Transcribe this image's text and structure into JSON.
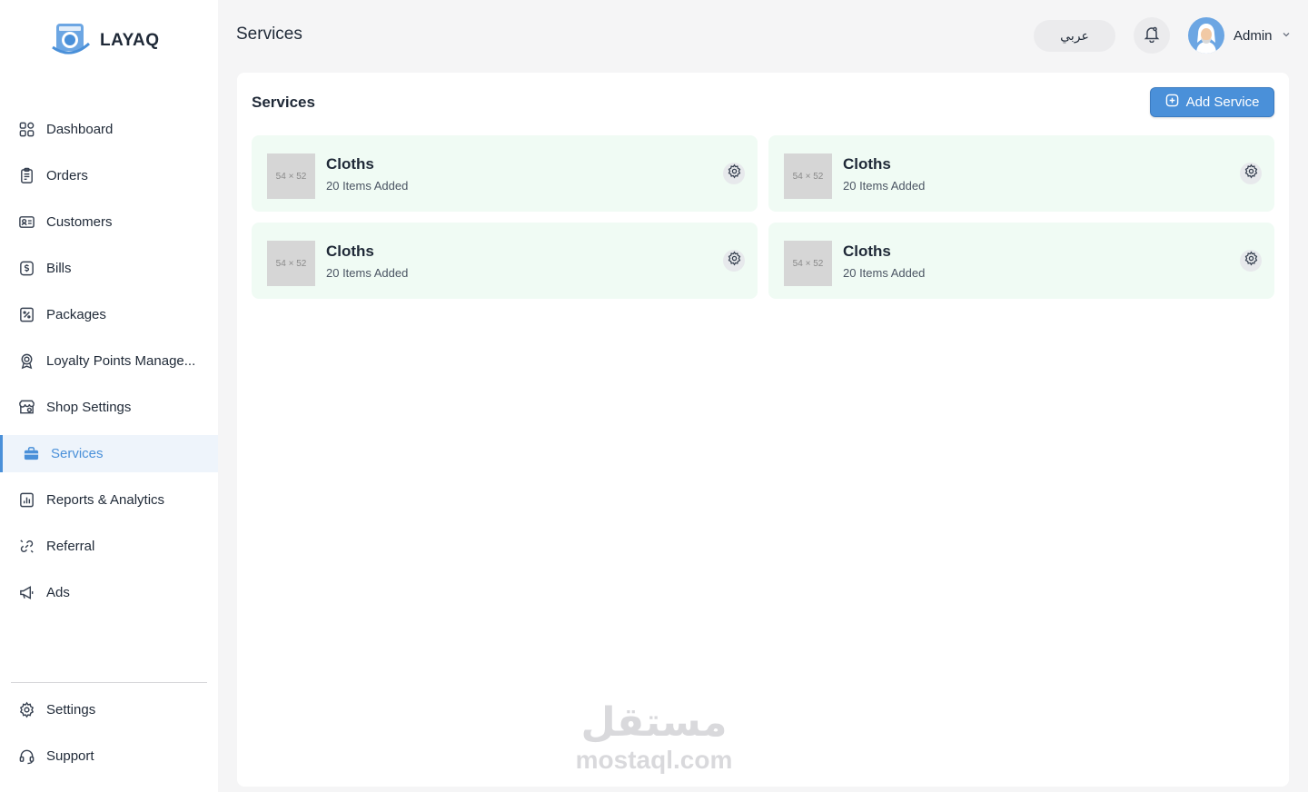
{
  "brand": {
    "name": "LAYAQ",
    "color": "#4a90d9"
  },
  "sidebar": {
    "items": [
      {
        "label": "Dashboard",
        "icon": "grid-icon",
        "active": false
      },
      {
        "label": "Orders",
        "icon": "clipboard-icon",
        "active": false
      },
      {
        "label": "Customers",
        "icon": "id-card-icon",
        "active": false
      },
      {
        "label": "Bills",
        "icon": "dollar-receipt-icon",
        "active": false
      },
      {
        "label": "Packages",
        "icon": "percent-tag-icon",
        "active": false
      },
      {
        "label": "Loyalty Points Manage...",
        "icon": "award-icon",
        "active": false
      },
      {
        "label": "Shop Settings",
        "icon": "shop-icon",
        "active": false
      },
      {
        "label": "Services",
        "icon": "briefcase-icon",
        "active": true
      },
      {
        "label": "Reports & Analytics",
        "icon": "report-chart-icon",
        "active": false
      },
      {
        "label": "Referral",
        "icon": "link-icon",
        "active": false
      },
      {
        "label": "Ads",
        "icon": "megaphone-icon",
        "active": false
      }
    ],
    "bottom": [
      {
        "label": "Settings",
        "icon": "gear-icon"
      },
      {
        "label": "Support",
        "icon": "headset-icon"
      }
    ]
  },
  "header": {
    "title": "Services",
    "language_button": "عربي",
    "user_name": "Admin"
  },
  "main": {
    "title": "Services",
    "add_button": "Add Service",
    "services": [
      {
        "name": "Cloths",
        "count": "20 Items Added",
        "thumb": "54 × 52"
      },
      {
        "name": "Cloths",
        "count": "20 Items Added",
        "thumb": "54 × 52"
      },
      {
        "name": "Cloths",
        "count": "20 Items Added",
        "thumb": "54 × 52"
      },
      {
        "name": "Cloths",
        "count": "20 Items Added",
        "thumb": "54 × 52"
      }
    ]
  },
  "watermark": {
    "arabic": "مستقل",
    "latin": "mostaql.com"
  }
}
